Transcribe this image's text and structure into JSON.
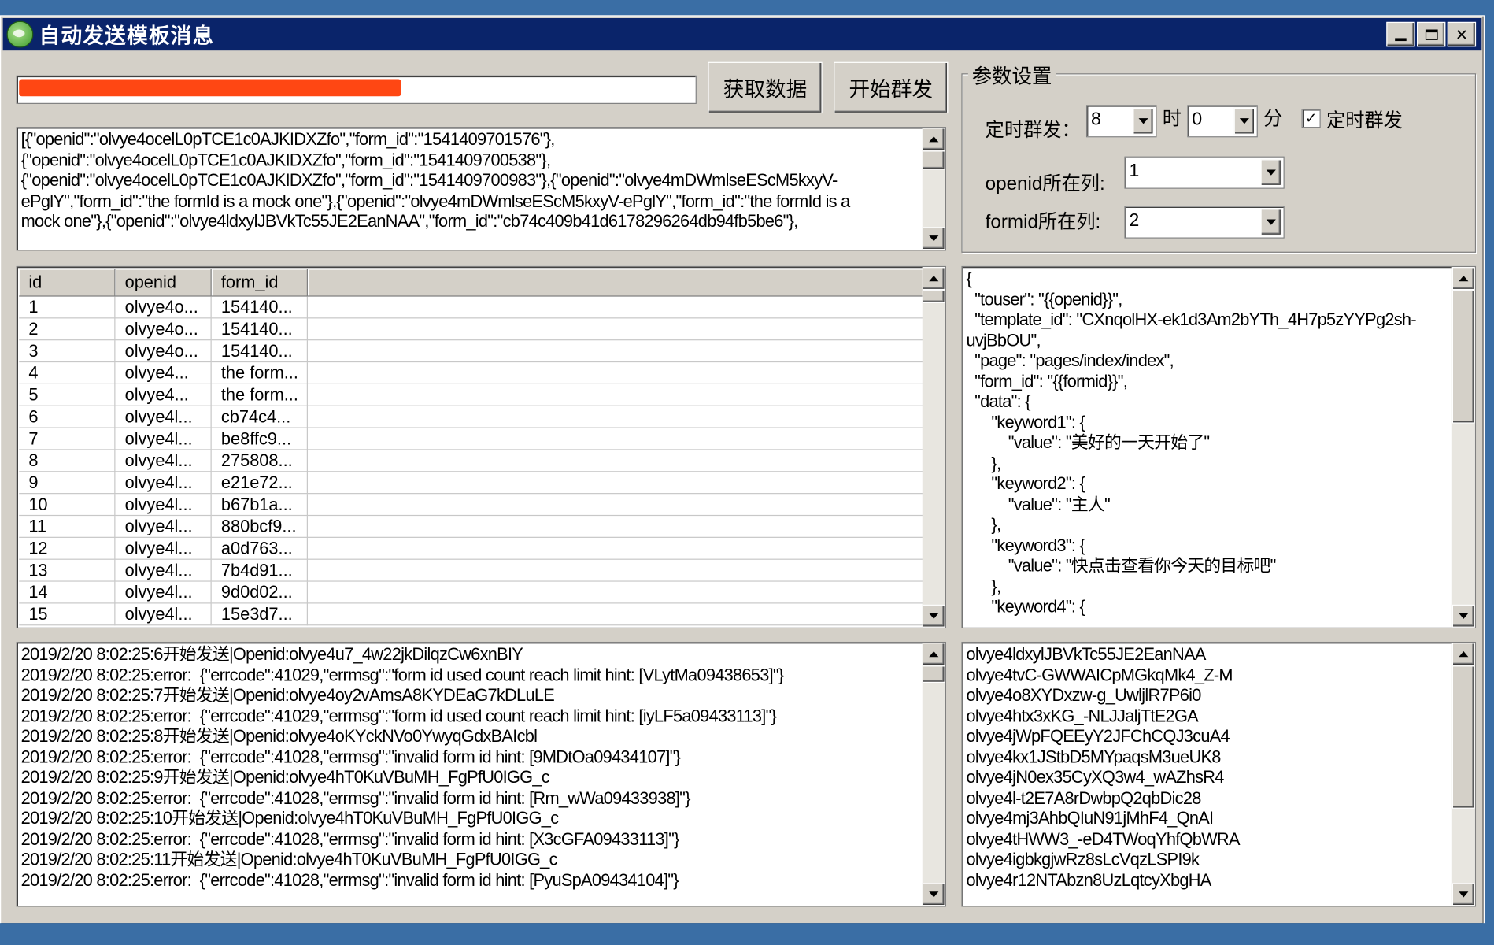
{
  "window": {
    "title": "自动发送模板消息",
    "controls": [
      "minimize",
      "maximize",
      "close"
    ]
  },
  "progress": {
    "fraction": 0.57
  },
  "buttons": {
    "fetch": "获取数据",
    "start": "开始群发"
  },
  "raw_data_lines": [
    "[{\"openid\":\"olvye4ocelL0pTCE1c0AJKIDXZfo\",\"form_id\":\"1541409701576\"},",
    "{\"openid\":\"olvye4ocelL0pTCE1c0AJKIDXZfo\",\"form_id\":\"1541409700538\"},",
    "{\"openid\":\"olvye4ocelL0pTCE1c0AJKIDXZfo\",\"form_id\":\"1541409700983\"},{\"openid\":\"olvye4mDWmlseEScM5kxyV-",
    "ePglY\",\"form_id\":\"the formId is a mock one\"},{\"openid\":\"olvye4mDWmlseEScM5kxyV-ePglY\",\"form_id\":\"the formId is a",
    "mock one\"},{\"openid\":\"olvye4ldxylJBVkTc55JE2EanNAA\",\"form_id\":\"cb74c409b41d6178296264db94fb5be6\"},"
  ],
  "params": {
    "group_title": "参数设置",
    "timer_label": "定时群发：",
    "hour_value": "8",
    "hour_unit": "时",
    "minute_value": "0",
    "minute_unit": "分",
    "timer_checkbox_label": "定时群发",
    "timer_checked": true,
    "openid_col_label": "openid所在列:",
    "openid_col_value": "1",
    "formid_col_label": "formid所在列:",
    "formid_col_value": "2"
  },
  "table": {
    "columns": [
      "id",
      "openid",
      "form_id"
    ],
    "rows": [
      [
        "1",
        "olvye4o...",
        "154140..."
      ],
      [
        "2",
        "olvye4o...",
        "154140..."
      ],
      [
        "3",
        "olvye4o...",
        "154140..."
      ],
      [
        "4",
        "olvye4...",
        "the form..."
      ],
      [
        "5",
        "olvye4...",
        "the form..."
      ],
      [
        "6",
        "olvye4l...",
        "cb74c4..."
      ],
      [
        "7",
        "olvye4l...",
        "be8ffc9..."
      ],
      [
        "8",
        "olvye4l...",
        "275808..."
      ],
      [
        "9",
        "olvye4l...",
        "e21e72..."
      ],
      [
        "10",
        "olvye4l...",
        "b67b1a..."
      ],
      [
        "11",
        "olvye4l...",
        "880bcf9..."
      ],
      [
        "12",
        "olvye4l...",
        "a0d763..."
      ],
      [
        "13",
        "olvye4l...",
        "7b4d91..."
      ],
      [
        "14",
        "olvye4l...",
        "9d0d02..."
      ],
      [
        "15",
        "olvye4l...",
        "15e3d7..."
      ]
    ]
  },
  "template_lines": [
    "{",
    "  \"touser\": \"{{openid}}\",",
    "  \"template_id\": \"CXnqolHX-ek1d3Am2bYTh_4H7p5zYYPg2sh-",
    "uvjBbOU\",",
    "  \"page\": \"pages/index/index\",",
    "  \"form_id\": \"{{formid}}\",",
    "  \"data\": {",
    "      \"keyword1\": {",
    "          \"value\": \"美好的一天开始了\"",
    "      },",
    "      \"keyword2\": {",
    "          \"value\": \"主人\"",
    "      },",
    "      \"keyword3\": {",
    "          \"value\": \"快点击查看你今天的目标吧\"",
    "      },",
    "      \"keyword4\": {"
  ],
  "log_lines": [
    "2019/2/20 8:02:25:6开始发送|Openid:olvye4u7_4w22jkDilqzCw6xnBIY",
    "2019/2/20 8:02:25:error:  {\"errcode\":41029,\"errmsg\":\"form id used count reach limit hint: [VLytMa09438653]\"}",
    "2019/2/20 8:02:25:7开始发送|Openid:olvye4oy2vAmsA8KYDEaG7kDLuLE",
    "2019/2/20 8:02:25:error:  {\"errcode\":41029,\"errmsg\":\"form id used count reach limit hint: [iyLF5a09433113]\"}",
    "2019/2/20 8:02:25:8开始发送|Openid:olvye4oKYckNVo0YwyqGdxBAIcbl",
    "2019/2/20 8:02:25:error:  {\"errcode\":41028,\"errmsg\":\"invalid form id hint: [9MDtOa09434107]\"}",
    "2019/2/20 8:02:25:9开始发送|Openid:olvye4hT0KuVBuMH_FgPfU0IGG_c",
    "2019/2/20 8:02:25:error:  {\"errcode\":41028,\"errmsg\":\"invalid form id hint: [Rm_wWa09433938]\"}",
    "2019/2/20 8:02:25:10开始发送|Openid:olvye4hT0KuVBuMH_FgPfU0IGG_c",
    "2019/2/20 8:02:25:error:  {\"errcode\":41028,\"errmsg\":\"invalid form id hint: [X3cGFA09433113]\"}",
    "2019/2/20 8:02:25:11开始发送|Openid:olvye4hT0KuVBuMH_FgPfU0IGG_c",
    "2019/2/20 8:02:25:error:  {\"errcode\":41028,\"errmsg\":\"invalid form id hint: [PyuSpA09434104]\"}"
  ],
  "openid_list": [
    "olvye4ldxylJBVkTc55JE2EanNAA",
    "olvye4tvC-GWWAICpMGkqMk4_Z-M",
    "olvye4o8XYDxzw-g_UwljlR7P6i0",
    "olvye4htx3xKG_-NLJJaljTtE2GA",
    "olvye4jWpFQEEyY2JFChCQJ3cuA4",
    "olvye4kx1JStbD5MYpaqsM3ueUK8",
    "olvye4jN0ex35CyXQ3w4_wAZhsR4",
    "olvye4l-t2E7A8rDwbpQ2qbDic28",
    "olvye4mj3AhbQIuN91jMhF4_QnAI",
    "olvye4tHWW3_-eD4TWoqYhfQbWRA",
    "olvye4igbkgjwRz8sLcVqzLSPI9k",
    "olvye4r12NTAbzn8UzLqtcyXbgHA"
  ]
}
